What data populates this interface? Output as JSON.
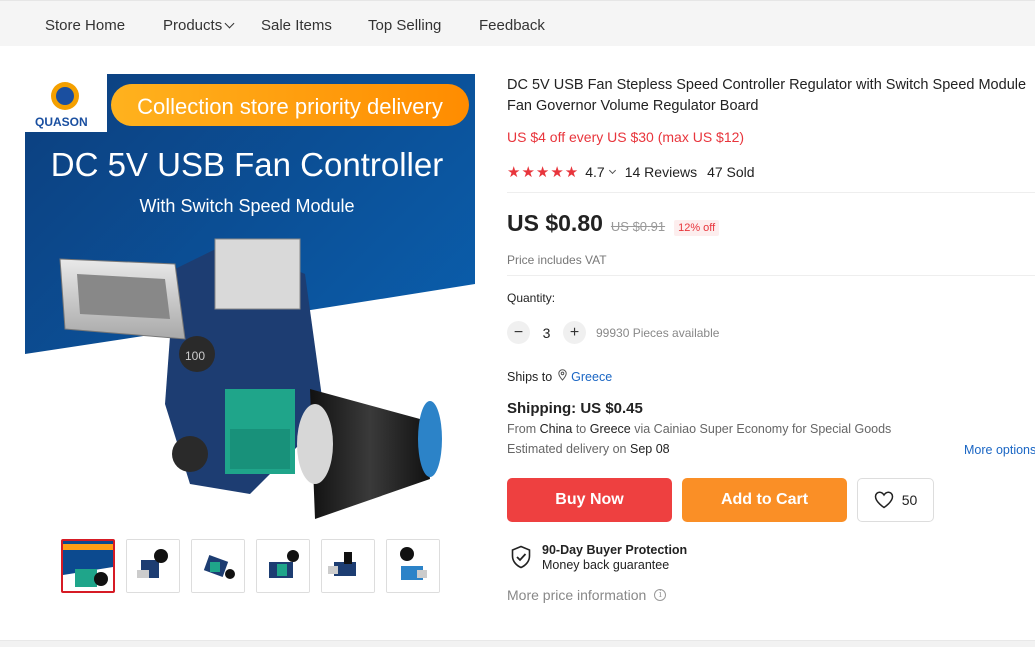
{
  "nav": {
    "items": [
      "Store Home",
      "Products",
      "Sale Items",
      "Top Selling",
      "Feedback"
    ]
  },
  "banner": {
    "brand": "QUASON",
    "ribbon": "Collection store priority delivery",
    "headline": "DC 5V USB Fan Controller",
    "subhead": "With Switch Speed Module",
    "chip_label": "100"
  },
  "product": {
    "title": "DC 5V USB Fan Stepless Speed Controller Regulator with Switch Speed Module Fan Governor Volume Regulator Board",
    "promo": "US $4 off every US $30 (max US $12)",
    "rating": "4.7",
    "reviews": "14 Reviews",
    "sold": "47 Sold",
    "price": "US $0.80",
    "old_price": "US $0.91",
    "discount": "12% off",
    "vat": "Price includes VAT"
  },
  "quantity": {
    "label": "Quantity:",
    "value": "3",
    "minus": "−",
    "plus": "+",
    "available": "99930 Pieces available"
  },
  "shipping": {
    "ships_to_label": "Ships to",
    "country": "Greece",
    "cost": "Shipping: US $0.45",
    "from_prefix": "From",
    "from": "China",
    "to_prefix": "to",
    "to": "Greece",
    "via": "via Cainiao Super Economy for Special Goods",
    "delivery_prefix": "Estimated delivery on",
    "delivery_date": "Sep 08",
    "more_options": "More options"
  },
  "actions": {
    "buy_now": "Buy Now",
    "add_to_cart": "Add to Cart",
    "wish_count": "50"
  },
  "protection": {
    "title": "90-Day Buyer Protection",
    "subtitle": "Money back guarantee"
  },
  "more_info": "More price information",
  "colors": {
    "accent_red": "#ee4040",
    "accent_orange": "#fa8f26",
    "link_blue": "#1a66c4"
  }
}
